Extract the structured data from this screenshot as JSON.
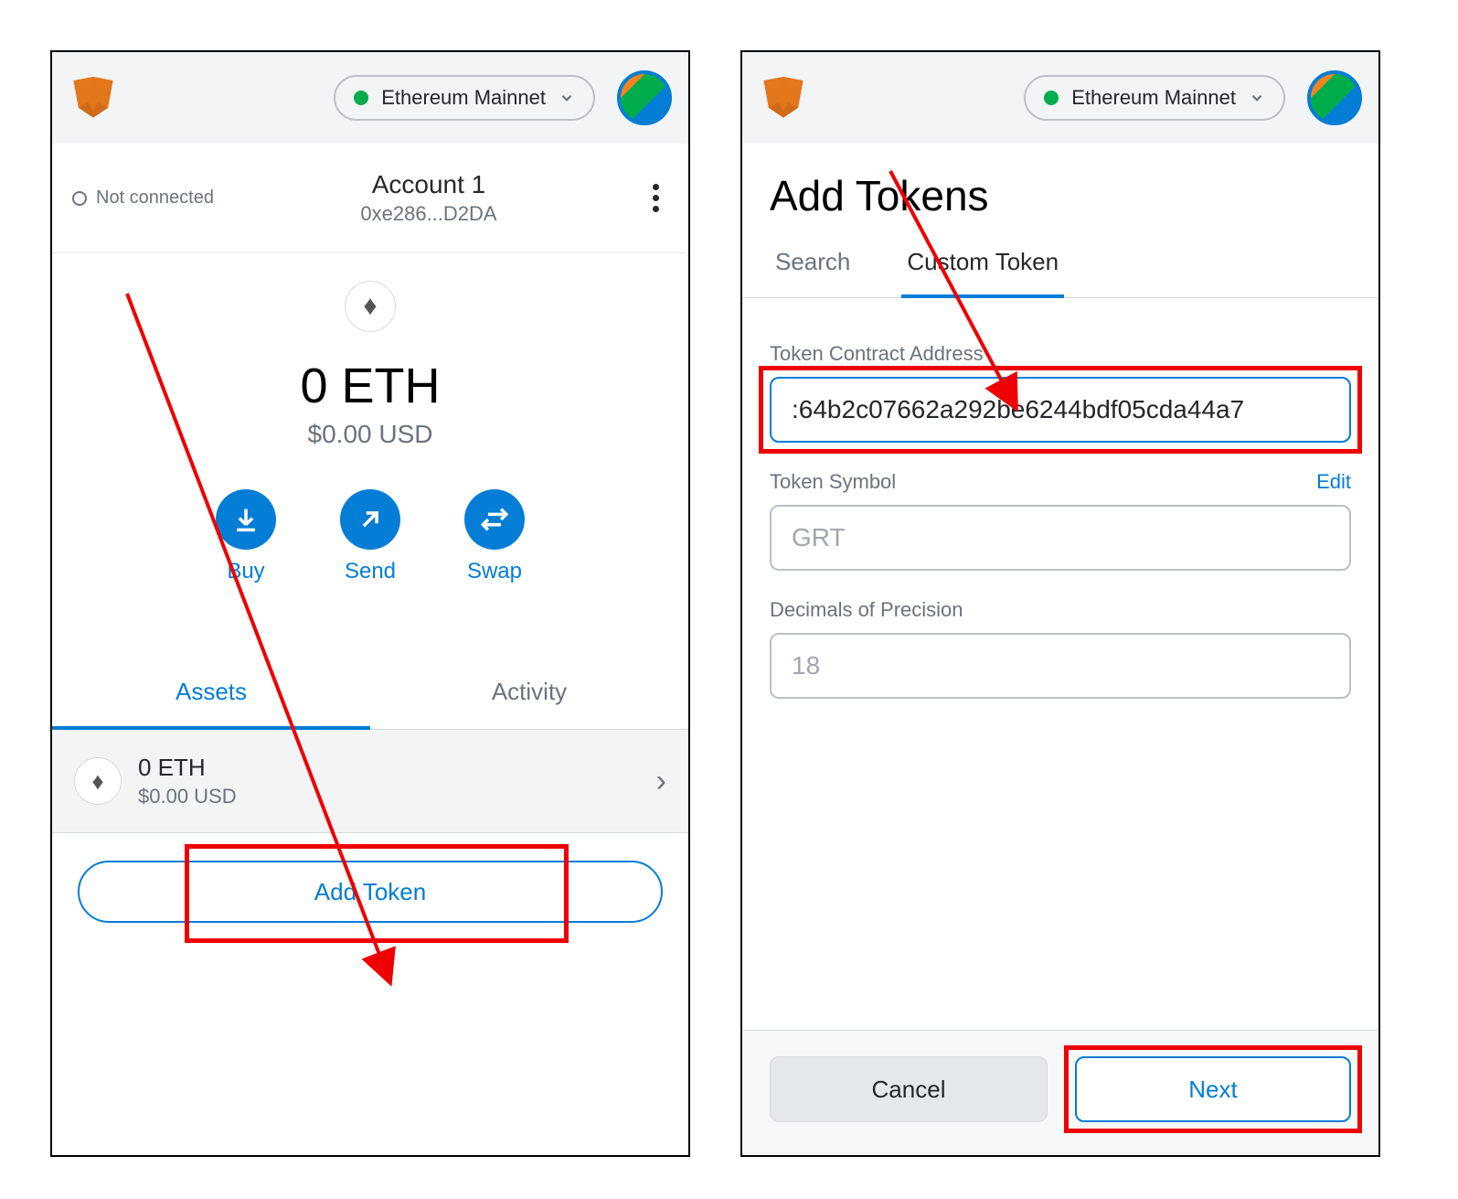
{
  "header": {
    "network_label": "Ethereum Mainnet"
  },
  "left": {
    "connection_status": "Not connected",
    "account_name": "Account 1",
    "account_address": "0xe286...D2DA",
    "balance_main": "0 ETH",
    "balance_usd": "$0.00 USD",
    "actions": {
      "buy": "Buy",
      "send": "Send",
      "swap": "Swap"
    },
    "tabs": {
      "assets": "Assets",
      "activity": "Activity"
    },
    "asset": {
      "balance": "0 ETH",
      "usd": "$0.00 USD"
    },
    "add_token_label": "Add Token"
  },
  "right": {
    "title": "Add Tokens",
    "tabs": {
      "search": "Search",
      "custom": "Custom Token"
    },
    "fields": {
      "address_label": "Token Contract Address",
      "address_value": ":64b2c07662a292be6244bdf05cda44a7",
      "symbol_label": "Token Symbol",
      "symbol_edit": "Edit",
      "symbol_value": "GRT",
      "decimals_label": "Decimals of Precision",
      "decimals_value": "18"
    },
    "buttons": {
      "cancel": "Cancel",
      "next": "Next"
    }
  }
}
